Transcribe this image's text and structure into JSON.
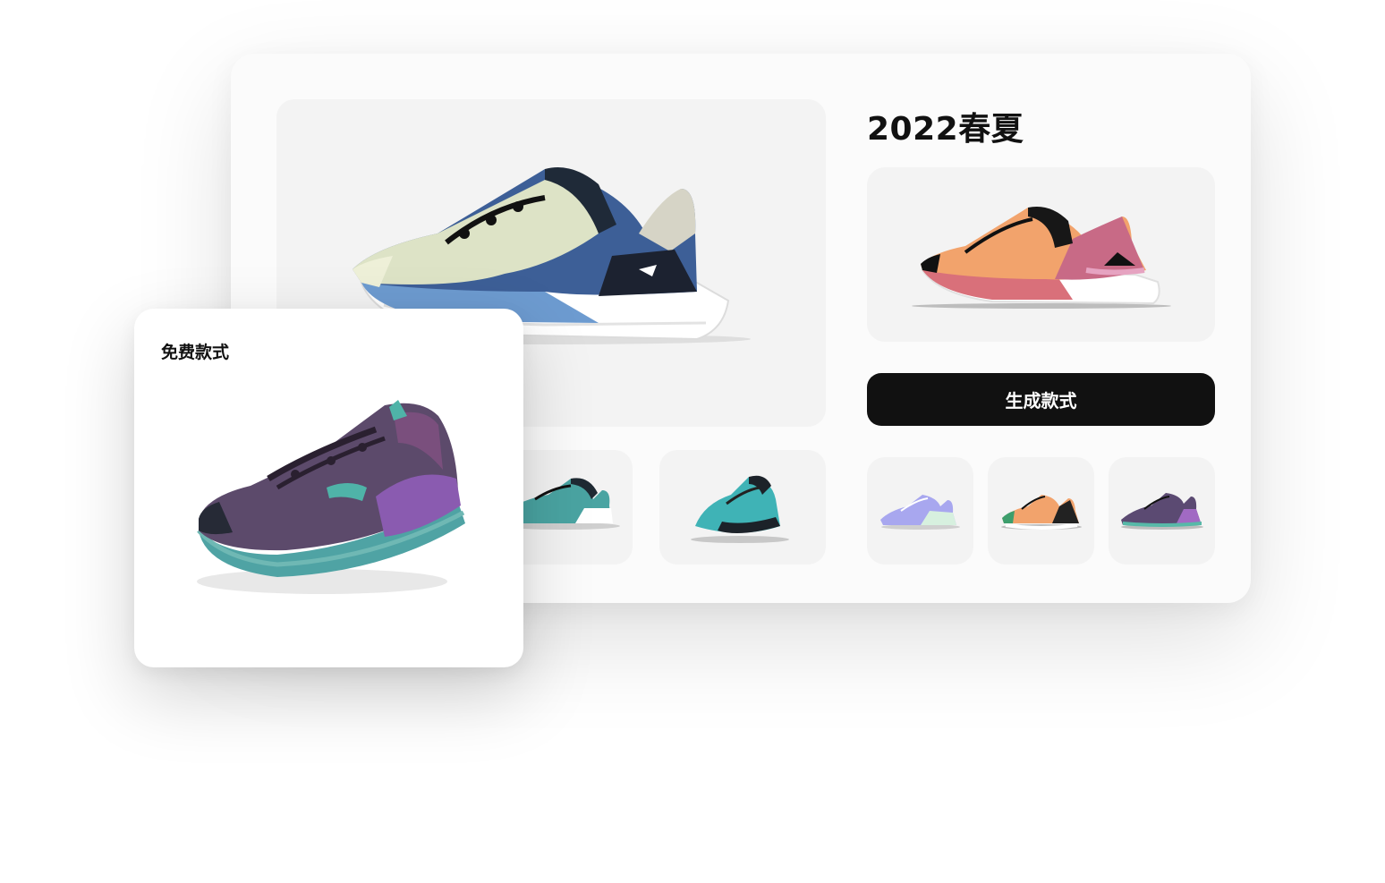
{
  "collection": {
    "title": "2022春夏",
    "generate_label": "生成款式"
  },
  "free_card": {
    "label": "免费款式"
  },
  "colors": {
    "button_bg": "#111111",
    "tile_bg": "#f3f3f3",
    "card_bg": "#fbfbfb"
  },
  "products": {
    "hero": "shoe-cream-blue-icon",
    "small_tiles": [
      "shoe-teal-icon",
      "shoe-teal-front-icon"
    ],
    "preview": "shoe-orange-pink-icon",
    "thumbnails": [
      "shoe-lavender-icon",
      "shoe-orange-pink-icon",
      "shoe-purple-icon"
    ],
    "free": "shoe-purple-metallic-icon"
  }
}
